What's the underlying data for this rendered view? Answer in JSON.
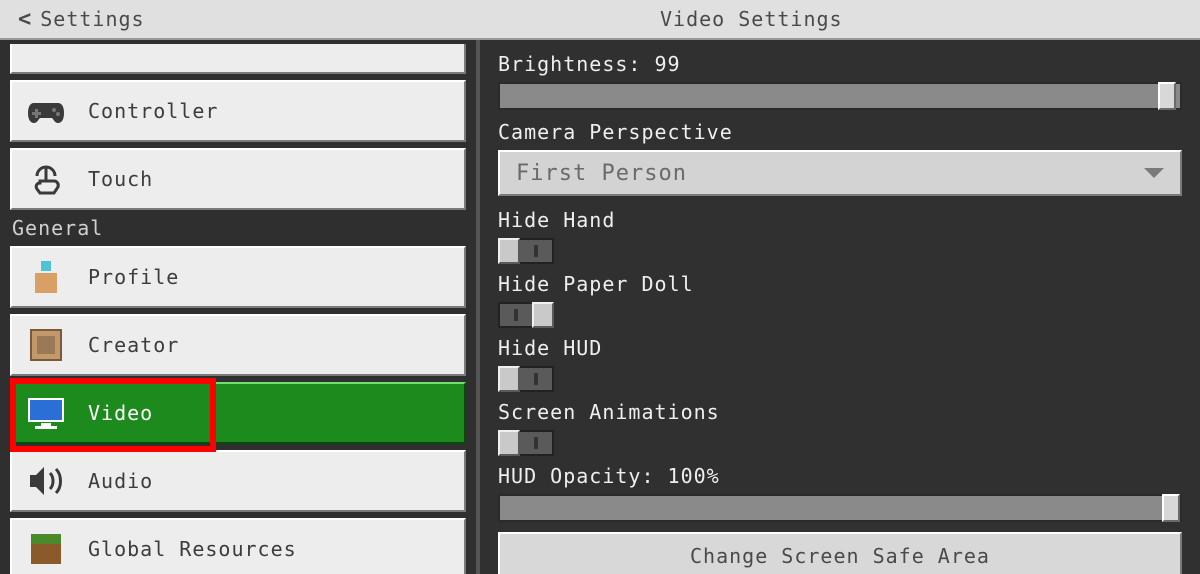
{
  "topbar": {
    "back_label": "Settings",
    "title": "Video Settings"
  },
  "sidebar": {
    "items_top": [
      {
        "label": "",
        "icon": "keyboard-icon"
      },
      {
        "label": "Controller",
        "icon": "gamepad-icon"
      },
      {
        "label": "Touch",
        "icon": "touch-icon"
      }
    ],
    "section_label": "General",
    "items_general": [
      {
        "label": "Profile",
        "icon": "profile-icon"
      },
      {
        "label": "Creator",
        "icon": "creator-icon"
      },
      {
        "label": "Video",
        "icon": "monitor-icon",
        "selected": true
      },
      {
        "label": "Audio",
        "icon": "speaker-icon"
      },
      {
        "label": "Global Resources",
        "icon": "grass-block-icon"
      }
    ]
  },
  "content": {
    "brightness": {
      "label": "Brightness: 99",
      "percent": 99
    },
    "camera": {
      "label": "Camera Perspective",
      "value": "First Person"
    },
    "hide_hand": {
      "label": "Hide Hand",
      "on": false
    },
    "hide_paper_doll": {
      "label": "Hide Paper Doll",
      "on": true
    },
    "hide_hud": {
      "label": "Hide HUD",
      "on": false
    },
    "screen_animations": {
      "label": "Screen Animations",
      "on": false
    },
    "hud_opacity": {
      "label": "HUD Opacity: 100%",
      "percent": 100
    },
    "change_safe_area": "Change Screen Safe Area"
  }
}
